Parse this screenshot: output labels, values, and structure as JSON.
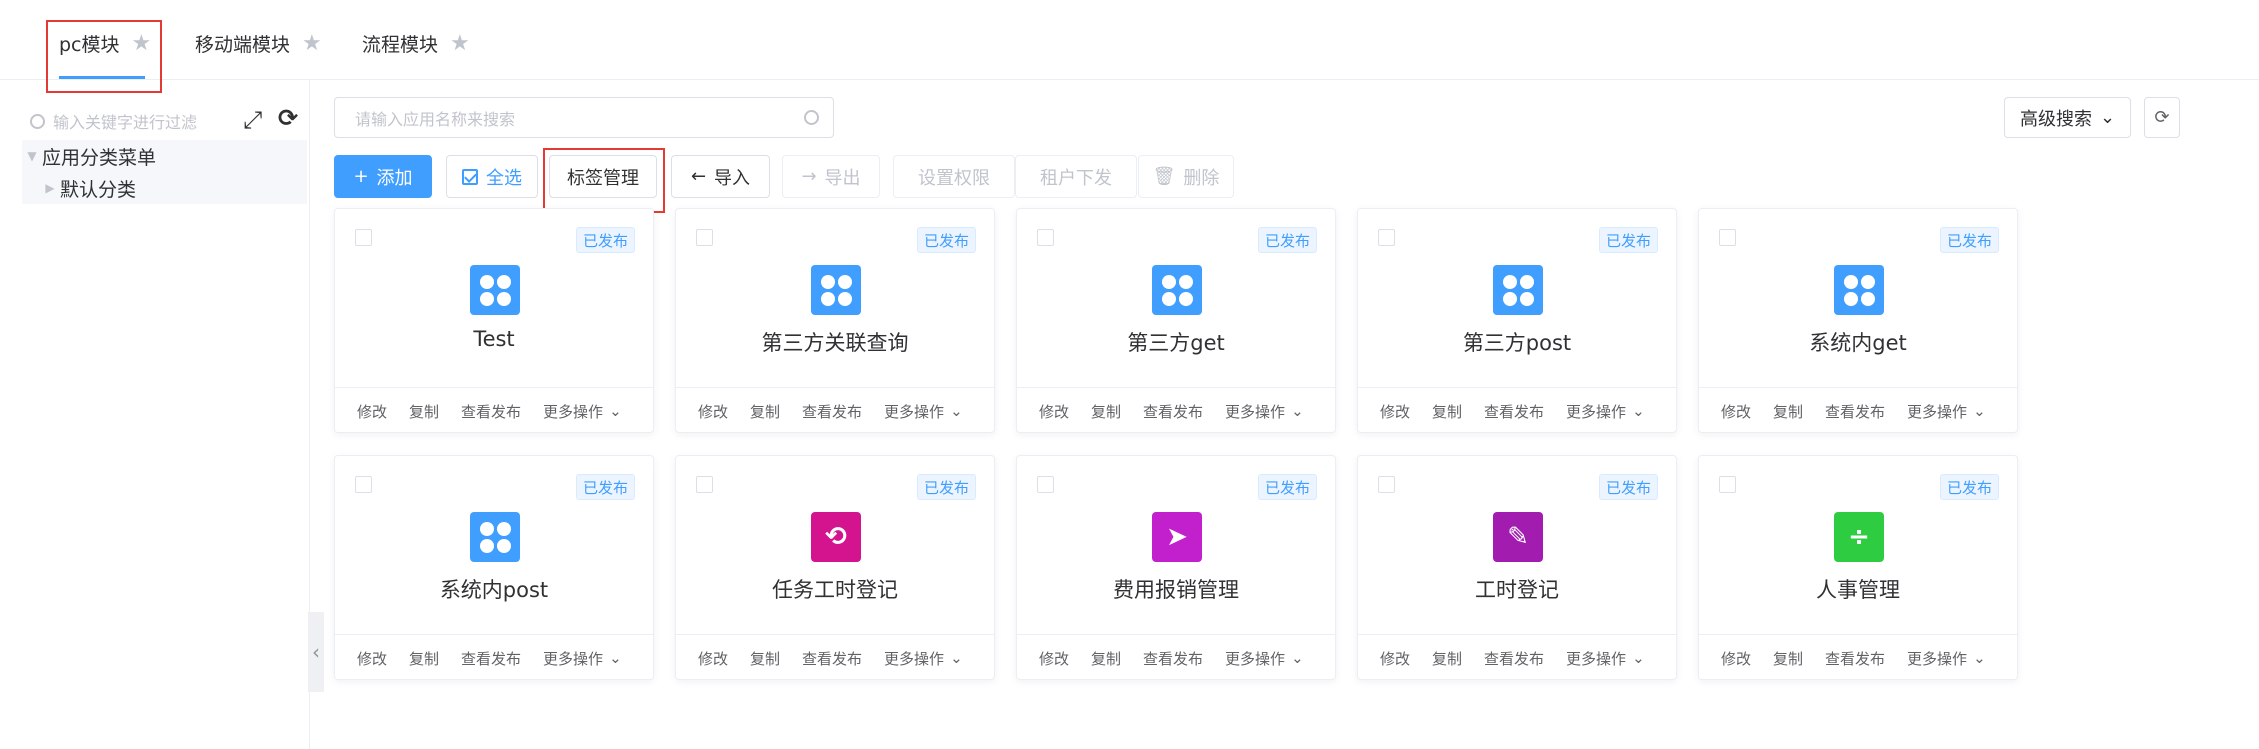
{
  "tabs": [
    {
      "label": "pc模块",
      "star": "★"
    },
    {
      "label": "移动端模块",
      "star": "★"
    },
    {
      "label": "流程模块",
      "star": "★"
    }
  ],
  "left_panel": {
    "filter_placeholder": "输入关键字进行过滤",
    "tree": {
      "root": "应用分类菜单",
      "children": [
        "默认分类"
      ]
    },
    "icons": {
      "expand": "⤢",
      "refresh": "⟳",
      "collapse": "‹"
    }
  },
  "search": {
    "placeholder": "请输入应用名称来搜索"
  },
  "advanced": {
    "label": "高级搜索",
    "chevron": "⌄",
    "refresh": "⟳"
  },
  "toolbar": {
    "add": "添加",
    "add_icon": "+",
    "select_all": "全选",
    "tag_manage": "标签管理",
    "import": "导入",
    "import_icon": "←",
    "export": "导出",
    "export_icon": "→",
    "permission": "设置权限",
    "tenant": "租户下发",
    "delete": "删除",
    "delete_icon": "🗑"
  },
  "cards": [
    {
      "title": "Test",
      "status": "已发布",
      "icon": "clover-icon",
      "color": "#409eff"
    },
    {
      "title": "第三方关联查询",
      "status": "已发布",
      "icon": "clover-icon",
      "color": "#409eff"
    },
    {
      "title": "第三方get",
      "status": "已发布",
      "icon": "clover-icon",
      "color": "#409eff"
    },
    {
      "title": "第三方post",
      "status": "已发布",
      "icon": "clover-icon",
      "color": "#409eff"
    },
    {
      "title": "系统内get",
      "status": "已发布",
      "icon": "clover-icon",
      "color": "#409eff"
    },
    {
      "title": "系统内post",
      "status": "已发布",
      "icon": "clover-icon",
      "color": "#409eff"
    },
    {
      "title": "任务工时登记",
      "status": "已发布",
      "icon": "task-icon",
      "color": "#d4148f"
    },
    {
      "title": "费用报销管理",
      "status": "已发布",
      "icon": "paper-plane-icon",
      "color": "#c21fcd"
    },
    {
      "title": "工时登记",
      "status": "已发布",
      "icon": "edit-note-icon",
      "color": "#a21caf"
    },
    {
      "title": "人事管理",
      "status": "已发布",
      "icon": "divide-icon",
      "color": "#2ecc40"
    }
  ],
  "card_actions": {
    "edit": "修改",
    "copy": "复制",
    "view": "查看发布",
    "more": "更多操作",
    "more_icon": "⌄"
  }
}
